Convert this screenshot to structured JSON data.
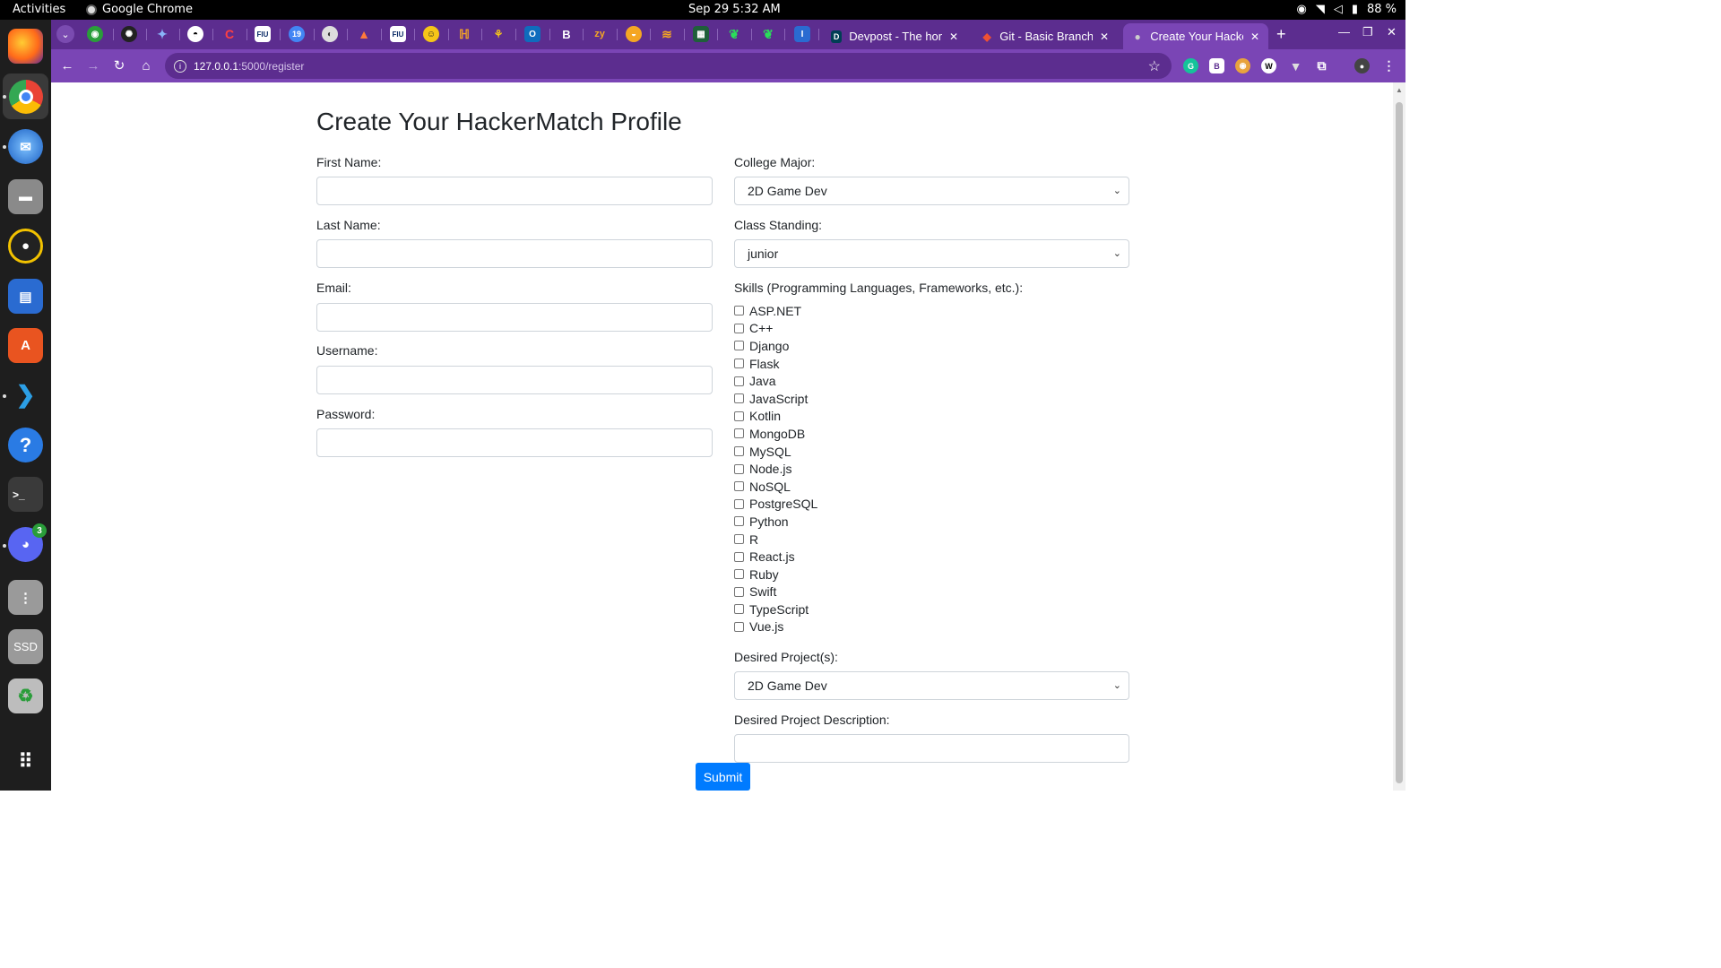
{
  "topbar": {
    "activities": "Activities",
    "app_name": "Google Chrome",
    "clock": "Sep 29  5:32 AM",
    "battery": "88 %"
  },
  "dock": {
    "items": [
      "firefox-icon",
      "chrome-icon",
      "thunderbird-icon",
      "files-icon",
      "rhythmbox-icon",
      "writer-icon",
      "app-center-icon",
      "vscode-icon",
      "help-icon",
      "terminal-icon",
      "discord-icon",
      "drive-icon",
      "ssd-icon",
      "trash-icon",
      "app-grid-icon"
    ],
    "discord_badge": "3",
    "ssd_label": "SSD"
  },
  "browser": {
    "pinned_badge": "19",
    "tabs": [
      {
        "title": "Devpost - The home",
        "fav": "D"
      },
      {
        "title": "Git - Basic Branching",
        "fav": "◆"
      },
      {
        "title": "Create Your Hacker",
        "fav": "●"
      }
    ],
    "url_host": "127.0.0.1",
    "url_path": ":5000/register"
  },
  "form": {
    "title": "Create Your HackerMatch Profile",
    "first_name_label": "First Name:",
    "last_name_label": "Last Name:",
    "email_label": "Email:",
    "username_label": "Username:",
    "password_label": "Password:",
    "first_name_value": "",
    "last_name_value": "",
    "email_value": "",
    "username_value": "",
    "password_value": "",
    "major_label": "College Major:",
    "major_value": "2D Game Dev",
    "standing_label": "Class Standing:",
    "standing_value": "junior",
    "skills_label": "Skills (Programming Languages, Frameworks, etc.):",
    "skills": [
      "ASP.NET",
      "C++",
      "Django",
      "Flask",
      "Java",
      "JavaScript",
      "Kotlin",
      "MongoDB",
      "MySQL",
      "Node.js",
      "NoSQL",
      "PostgreSQL",
      "Python",
      "R",
      "React.js",
      "Ruby",
      "Swift",
      "TypeScript",
      "Vue.js"
    ],
    "projects_label": "Desired Project(s):",
    "projects_value": "2D Game Dev",
    "description_label": "Desired Project Description:",
    "description_value": "",
    "submit_label": "Submit"
  },
  "colors": {
    "tabstrip": "#5c2d8f",
    "toolbar": "#7a45b5",
    "submit": "#007bff"
  }
}
